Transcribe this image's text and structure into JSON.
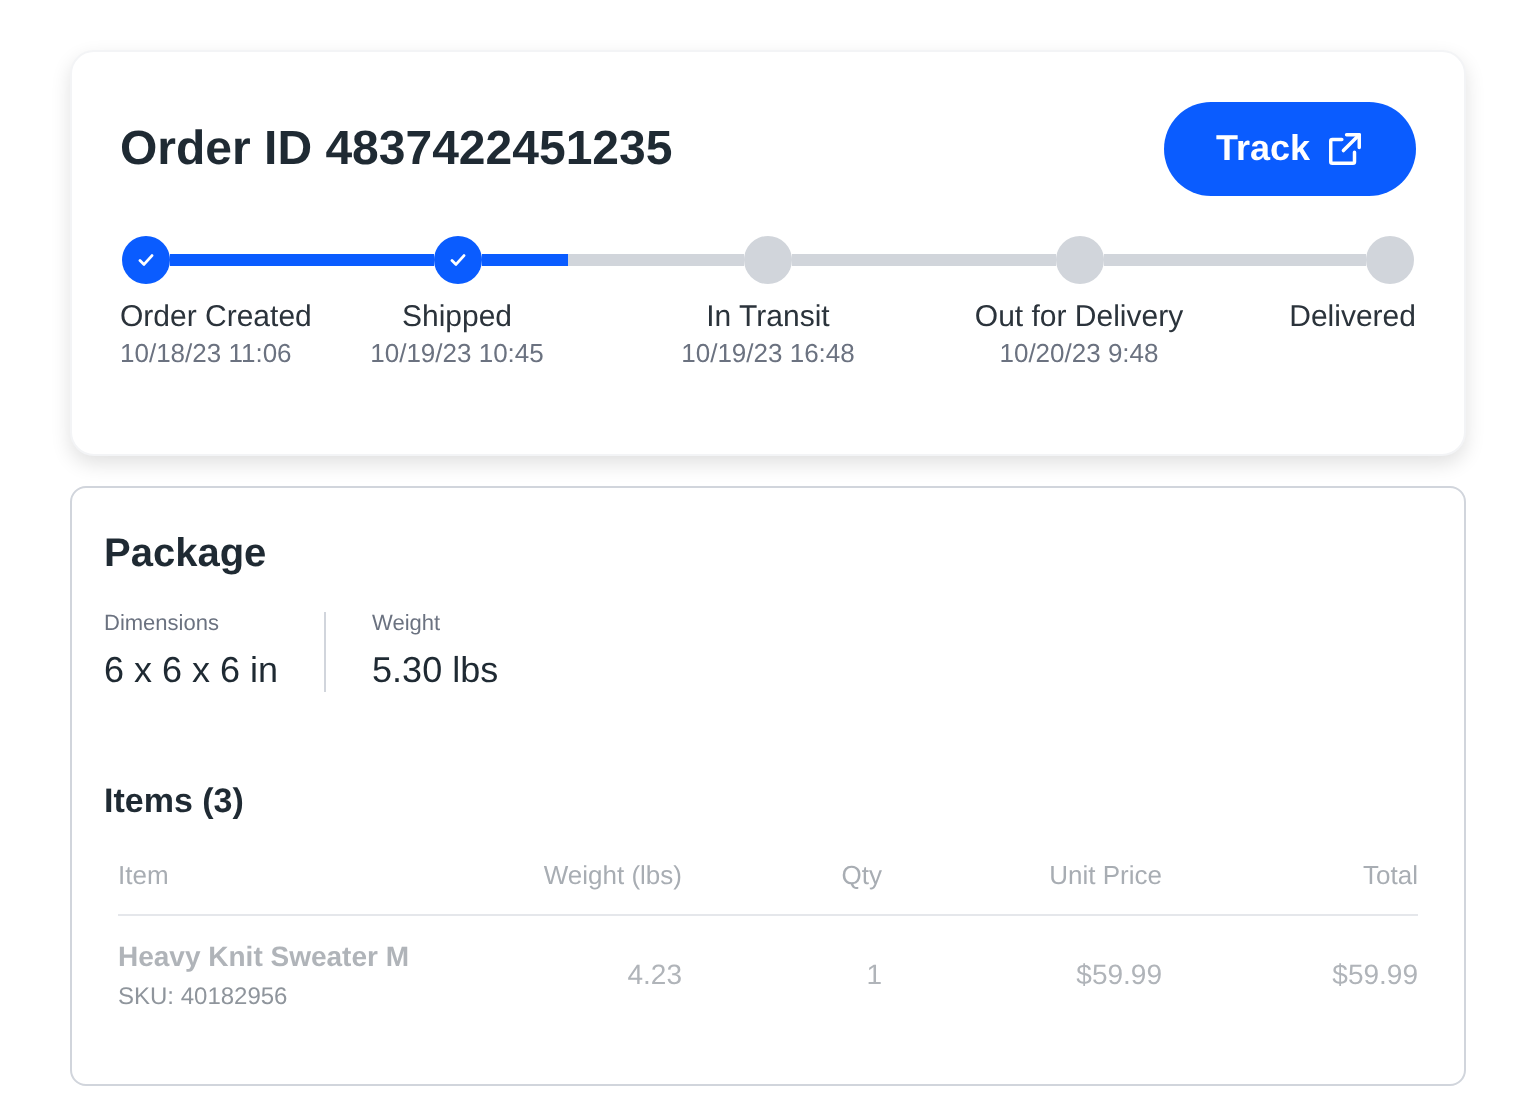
{
  "order": {
    "title": "Order ID 4837422451235",
    "track_button": "Track"
  },
  "steps": [
    {
      "label": "Order Created",
      "time": "10/18/23 11:06",
      "done": true
    },
    {
      "label": "Shipped",
      "time": "10/19/23 10:45",
      "done": true
    },
    {
      "label": "In Transit",
      "time": "10/19/23 16:48",
      "done": false
    },
    {
      "label": "Out for Delivery",
      "time": "10/20/23 9:48",
      "done": false
    },
    {
      "label": "Delivered",
      "done": false
    }
  ],
  "package": {
    "title": "Package",
    "stats": [
      {
        "label": "Dimensions",
        "value": "6 x 6 x 6 in"
      },
      {
        "label": "Weight",
        "value": "5.30 lbs"
      }
    ]
  },
  "items": {
    "title": "Items (3)",
    "columns": [
      "Item",
      "Weight (lbs)",
      "Qty",
      "Unit Price",
      "Total"
    ],
    "rows": [
      {
        "name": "Heavy Knit Sweater M",
        "sku": "SKU: 40182956",
        "weight": "4.23",
        "qty": "1",
        "unit_price": "$59.99",
        "total": "$59.99"
      }
    ]
  }
}
